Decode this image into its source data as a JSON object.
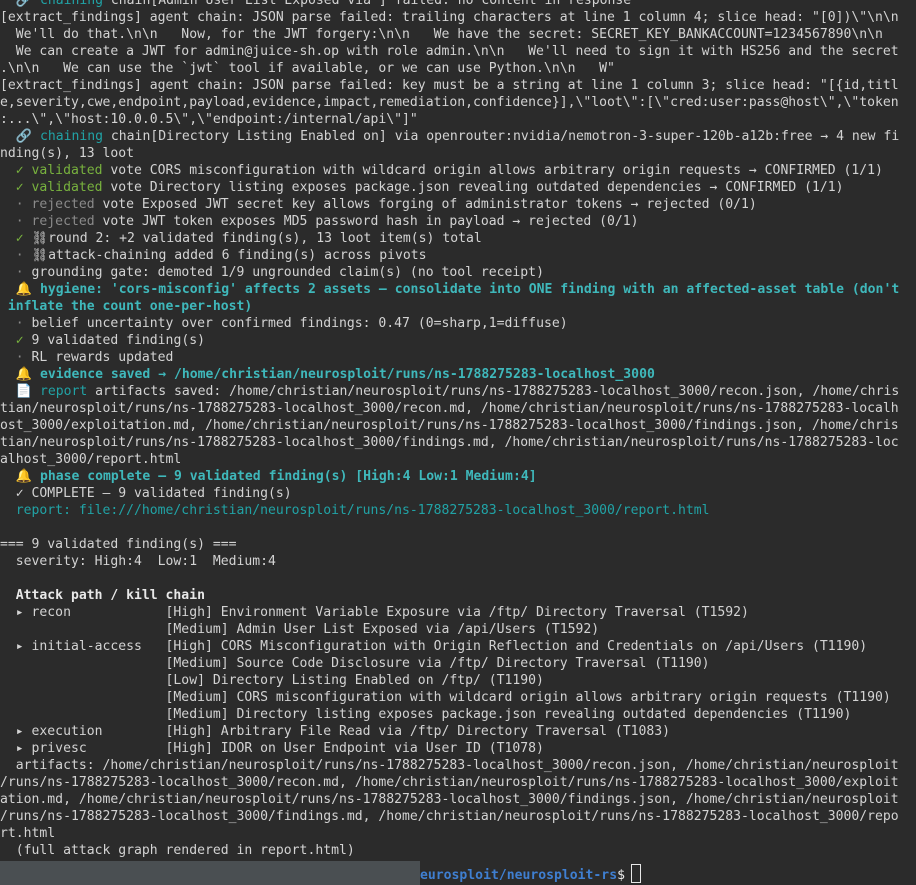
{
  "lines": [
    {
      "segs": [
        {
          "c": "cyan",
          "t": "  🔗 chaining "
        },
        {
          "c": "",
          "t": "chain[Admin User List Exposed via ] failed: no content in response"
        }
      ]
    },
    {
      "segs": [
        {
          "c": "",
          "t": "[extract_findings] agent chain: JSON parse failed: trailing characters at line 1 column 4; slice head: \"[0])\\\"\\n\\n"
        }
      ]
    },
    {
      "segs": [
        {
          "c": "",
          "t": "  We'll do that.\\n\\n   Now, for the JWT forgery:\\n\\n   We have the secret: SECRET_KEY_BANKACCOUNT=1234567890\\n\\n"
        }
      ]
    },
    {
      "segs": [
        {
          "c": "",
          "t": "  We can create a JWT for admin@juice-sh.op with role admin.\\n\\n   We'll need to sign it with HS256 and the secret"
        }
      ]
    },
    {
      "segs": [
        {
          "c": "",
          "t": ".\\n\\n   We can use the `jwt` tool if available, or we can use Python.\\n\\n   W\""
        }
      ]
    },
    {
      "segs": [
        {
          "c": "",
          "t": "[extract_findings] agent chain: JSON parse failed: key must be a string at line 1 column 3; slice head: \"[{id,titl"
        }
      ]
    },
    {
      "segs": [
        {
          "c": "",
          "t": "e,severity,cwe,endpoint,payload,evidence,impact,remediation,confidence}],\\\"loot\\\":[\\\"cred:user:pass@host\\\",\\\"token"
        }
      ]
    },
    {
      "segs": [
        {
          "c": "",
          "t": ":...\\\",\\\"host:10.0.0.5\\\",\\\"endpoint:/internal/api\\\"]\""
        }
      ]
    },
    {
      "segs": [
        {
          "c": "cyan",
          "t": "  🔗 chaining "
        },
        {
          "c": "",
          "t": "chain[Directory Listing Enabled on] via openrouter:nvidia/nemotron-3-super-120b-a12b:free → 4 new fi"
        }
      ]
    },
    {
      "segs": [
        {
          "c": "",
          "t": "nding(s), 13 loot"
        }
      ]
    },
    {
      "segs": [
        {
          "c": "green",
          "t": "  ✓ validated "
        },
        {
          "c": "",
          "t": "vote CORS misconfiguration with wildcard origin allows arbitrary origin requests → CONFIRMED (1/1)"
        }
      ]
    },
    {
      "segs": [
        {
          "c": "green",
          "t": "  ✓ validated "
        },
        {
          "c": "",
          "t": "vote Directory listing exposes package.json revealing outdated dependencies → CONFIRMED (1/1)"
        }
      ]
    },
    {
      "segs": [
        {
          "c": "gray",
          "t": "  · rejected "
        },
        {
          "c": "",
          "t": "vote Exposed JWT secret key allows forging of administrator tokens → rejected (0/1)"
        }
      ]
    },
    {
      "segs": [
        {
          "c": "gray",
          "t": "  · rejected "
        },
        {
          "c": "",
          "t": "vote JWT token exposes MD5 password hash in payload → rejected (0/1)"
        }
      ]
    },
    {
      "segs": [
        {
          "c": "green",
          "t": "  ✓ "
        },
        {
          "c": "",
          "t": "⛓round 2: +2 validated finding(s), 13 loot item(s) total"
        }
      ]
    },
    {
      "segs": [
        {
          "c": "gray",
          "t": "  · "
        },
        {
          "c": "",
          "t": "⛓attack-chaining added 6 finding(s) across pivots"
        }
      ]
    },
    {
      "segs": [
        {
          "c": "gray",
          "t": "  · "
        },
        {
          "c": "",
          "t": "grounding gate: demoted 1/9 ungrounded claim(s) (no tool receipt)"
        }
      ]
    },
    {
      "segs": [
        {
          "c": "yellow",
          "t": "  🔔 "
        },
        {
          "c": "cyanb",
          "t": "hygiene: 'cors-misconfig' affects 2 assets — consolidate into ONE finding with an affected-asset table (don't"
        }
      ]
    },
    {
      "segs": [
        {
          "c": "cyanb",
          "t": " inflate the count one-per-host)"
        }
      ]
    },
    {
      "segs": [
        {
          "c": "gray",
          "t": "  · "
        },
        {
          "c": "",
          "t": "belief uncertainty over confirmed findings: 0.47 (0=sharp,1=diffuse)"
        }
      ]
    },
    {
      "segs": [
        {
          "c": "green",
          "t": "  ✓ "
        },
        {
          "c": "",
          "t": "9 validated finding(s)"
        }
      ]
    },
    {
      "segs": [
        {
          "c": "gray",
          "t": "  · "
        },
        {
          "c": "",
          "t": "RL rewards updated"
        }
      ]
    },
    {
      "segs": [
        {
          "c": "yellow",
          "t": "  🔔 "
        },
        {
          "c": "cyanb",
          "t": "evidence saved → /home/christian/neurosploit/runs/ns-1788275283-localhost_3000"
        }
      ]
    },
    {
      "segs": [
        {
          "c": "",
          "t": "  📄 "
        },
        {
          "c": "cyan",
          "t": "report "
        },
        {
          "c": "",
          "t": "artifacts saved: /home/christian/neurosploit/runs/ns-1788275283-localhost_3000/recon.json, /home/chris"
        }
      ]
    },
    {
      "segs": [
        {
          "c": "",
          "t": "tian/neurosploit/runs/ns-1788275283-localhost_3000/recon.md, /home/christian/neurosploit/runs/ns-1788275283-localh"
        }
      ]
    },
    {
      "segs": [
        {
          "c": "",
          "t": "ost_3000/exploitation.md, /home/christian/neurosploit/runs/ns-1788275283-localhost_3000/findings.json, /home/chris"
        }
      ]
    },
    {
      "segs": [
        {
          "c": "",
          "t": "tian/neurosploit/runs/ns-1788275283-localhost_3000/findings.md, /home/christian/neurosploit/runs/ns-1788275283-loc"
        }
      ]
    },
    {
      "segs": [
        {
          "c": "",
          "t": "alhost_3000/report.html"
        }
      ]
    },
    {
      "segs": [
        {
          "c": "yellow",
          "t": "  🔔 "
        },
        {
          "c": "cyanb",
          "t": "phase complete — 9 validated finding(s) [High:4 Low:1 Medium:4]"
        }
      ]
    },
    {
      "segs": [
        {
          "c": "",
          "t": "  ✓ COMPLETE — 9 validated finding(s)"
        }
      ]
    },
    {
      "segs": [
        {
          "c": "cyan",
          "t": "  report: file:///home/christian/neurosploit/runs/ns-1788275283-localhost_3000/report.html"
        }
      ]
    },
    {
      "segs": [
        {
          "c": "",
          "t": ""
        }
      ]
    },
    {
      "segs": [
        {
          "c": "",
          "t": "=== 9 validated finding(s) ==="
        }
      ]
    },
    {
      "segs": [
        {
          "c": "",
          "t": "  severity: High:4  Low:1  Medium:4"
        }
      ]
    },
    {
      "segs": [
        {
          "c": "",
          "t": ""
        }
      ]
    },
    {
      "segs": [
        {
          "c": "hl",
          "t": "  Attack path / kill chain"
        }
      ]
    },
    {
      "segs": [
        {
          "c": "",
          "t": "  ▸ recon            [High] Environment Variable Exposure via /ftp/ Directory Traversal (T1592)"
        }
      ]
    },
    {
      "segs": [
        {
          "c": "",
          "t": "                     [Medium] Admin User List Exposed via /api/Users (T1592)"
        }
      ]
    },
    {
      "segs": [
        {
          "c": "",
          "t": "  ▸ initial-access   [High] CORS Misconfiguration with Origin Reflection and Credentials on /api/Users (T1190)"
        }
      ]
    },
    {
      "segs": [
        {
          "c": "",
          "t": "                     [Medium] Source Code Disclosure via /ftp/ Directory Traversal (T1190)"
        }
      ]
    },
    {
      "segs": [
        {
          "c": "",
          "t": "                     [Low] Directory Listing Enabled on /ftp/ (T1190)"
        }
      ]
    },
    {
      "segs": [
        {
          "c": "",
          "t": "                     [Medium] CORS misconfiguration with wildcard origin allows arbitrary origin requests (T1190)"
        }
      ]
    },
    {
      "segs": [
        {
          "c": "",
          "t": "                     [Medium] Directory listing exposes package.json revealing outdated dependencies (T1190)"
        }
      ]
    },
    {
      "segs": [
        {
          "c": "",
          "t": "  ▸ execution        [High] Arbitrary File Read via /ftp/ Directory Traversal (T1083)"
        }
      ]
    },
    {
      "segs": [
        {
          "c": "",
          "t": "  ▸ privesc          [High] IDOR on User Endpoint via User ID (T1078)"
        }
      ]
    },
    {
      "segs": [
        {
          "c": "",
          "t": "  artifacts: /home/christian/neurosploit/runs/ns-1788275283-localhost_3000/recon.json, /home/christian/neurosploit"
        }
      ]
    },
    {
      "segs": [
        {
          "c": "",
          "t": "/runs/ns-1788275283-localhost_3000/recon.md, /home/christian/neurosploit/runs/ns-1788275283-localhost_3000/exploit"
        }
      ]
    },
    {
      "segs": [
        {
          "c": "",
          "t": "ation.md, /home/christian/neurosploit/runs/ns-1788275283-localhost_3000/findings.json, /home/christian/neurosploit"
        }
      ]
    },
    {
      "segs": [
        {
          "c": "",
          "t": "/runs/ns-1788275283-localhost_3000/findings.md, /home/christian/neurosploit/runs/ns-1788275283-localhost_3000/repo"
        }
      ]
    },
    {
      "segs": [
        {
          "c": "",
          "t": "rt.html"
        }
      ]
    },
    {
      "segs": [
        {
          "c": "",
          "t": "  (full attack graph rendered in report.html)"
        }
      ]
    }
  ],
  "prompt": {
    "path": "eurosploit/neurosploit-rs",
    "symbol": "$"
  }
}
